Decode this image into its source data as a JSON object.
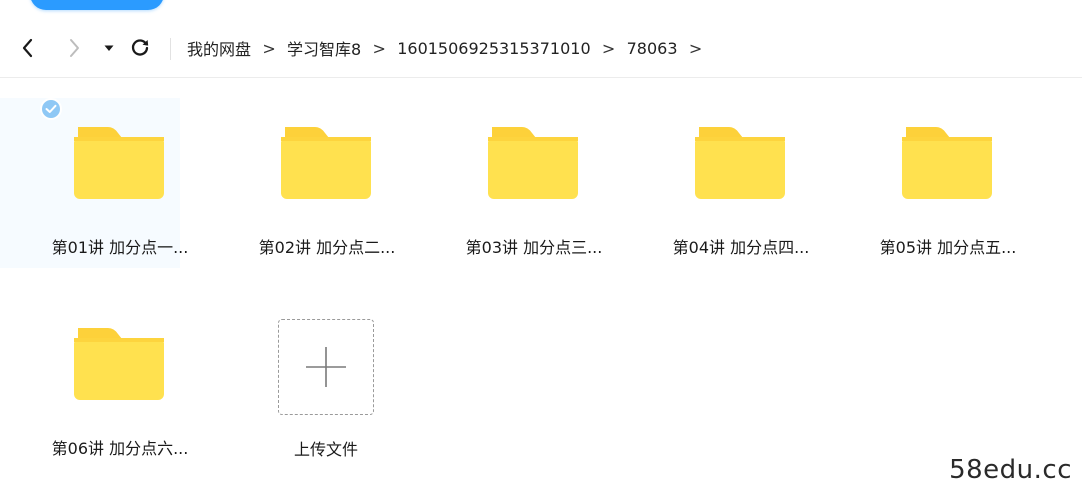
{
  "nav": {
    "back_icon": "chevron-left-icon",
    "forward_icon": "chevron-right-icon",
    "history_icon": "caret-down-icon",
    "refresh_icon": "refresh-icon"
  },
  "breadcrumb": [
    "我的网盘",
    "学习智库8",
    "1601506925315371010",
    "78063"
  ],
  "breadcrumb_separator": ">",
  "folders": [
    {
      "name": "第01讲 加分点一...",
      "selected": true
    },
    {
      "name": "第02讲 加分点二...",
      "selected": false
    },
    {
      "name": "第03讲 加分点三...",
      "selected": false
    },
    {
      "name": "第04讲 加分点四...",
      "selected": false
    },
    {
      "name": "第05讲 加分点五...",
      "selected": false
    },
    {
      "name": "第06讲 加分点六...",
      "selected": false
    }
  ],
  "upload": {
    "label": "上传文件",
    "icon": "plus-icon"
  },
  "watermark": "58edu.cc",
  "colors": {
    "accent": "#2b9bff",
    "folder_body": "#ffe14f",
    "folder_tab": "#fdd13a",
    "selected_check": "#8fc8f5"
  }
}
